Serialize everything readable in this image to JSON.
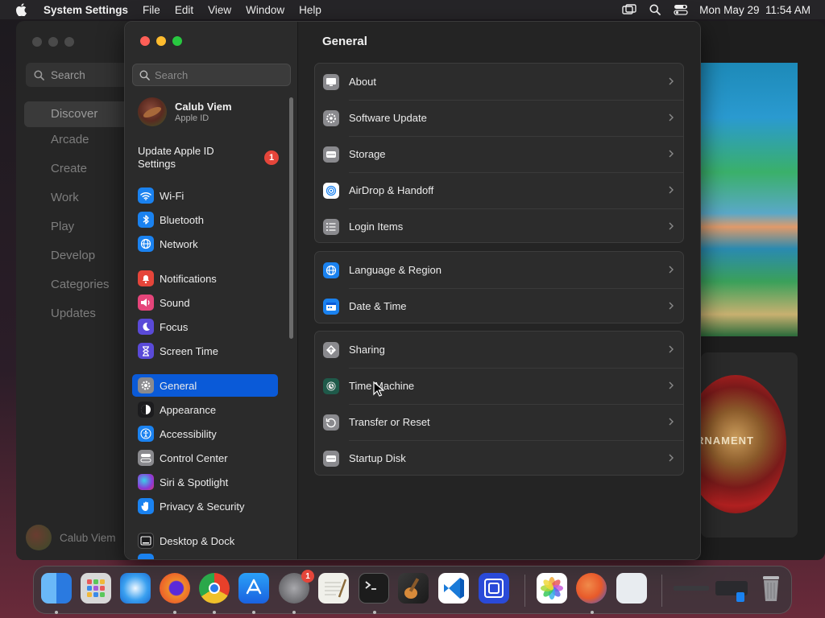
{
  "menubar": {
    "app": "System Settings",
    "items": [
      "File",
      "Edit",
      "View",
      "Window",
      "Help"
    ],
    "datetime": "Mon May 29  11:54 AM"
  },
  "appstore": {
    "search_placeholder": "Search",
    "nav": [
      "Discover",
      "Arcade",
      "Create",
      "Work",
      "Play",
      "Develop",
      "Categories",
      "Updates"
    ],
    "user": "Calub Viem",
    "art_text": "RNAMENT"
  },
  "settings": {
    "search_placeholder": "Search",
    "profile": {
      "name": "Calub Viem",
      "sub": "Apple ID"
    },
    "update": {
      "label": "Update Apple ID Settings",
      "badge": "1"
    },
    "sidebar": [
      {
        "label": "Wi-Fi",
        "icon": "wifi-icon",
        "color": "#1a82f0"
      },
      {
        "label": "Bluetooth",
        "icon": "bluetooth-icon",
        "color": "#1a82f0"
      },
      {
        "label": "Network",
        "icon": "globe-icon",
        "color": "#1a82f0"
      },
      {
        "label": "Notifications",
        "icon": "bell-icon",
        "color": "#e5453a"
      },
      {
        "label": "Sound",
        "icon": "speaker-icon",
        "color": "#e5457a"
      },
      {
        "label": "Focus",
        "icon": "moon-icon",
        "color": "#5a4ad8"
      },
      {
        "label": "Screen Time",
        "icon": "hourglass-icon",
        "color": "#5a4ad8"
      },
      {
        "label": "General",
        "icon": "gear-icon",
        "color": "#8a8a8e"
      },
      {
        "label": "Appearance",
        "icon": "appearance-icon",
        "color": "#1c1c1e"
      },
      {
        "label": "Accessibility",
        "icon": "accessibility-icon",
        "color": "#1a82f0"
      },
      {
        "label": "Control Center",
        "icon": "control-center-icon",
        "color": "#8a8a8e"
      },
      {
        "label": "Siri & Spotlight",
        "icon": "siri-icon",
        "color": "#8a3ad8"
      },
      {
        "label": "Privacy & Security",
        "icon": "hand-icon",
        "color": "#1a82f0"
      },
      {
        "label": "Desktop & Dock",
        "icon": "dock-icon",
        "color": "#1c1c1e"
      }
    ],
    "selected": "General",
    "title": "General",
    "groups": [
      [
        {
          "label": "About",
          "icon": "computer-icon",
          "color": "#8a8a8e"
        },
        {
          "label": "Software Update",
          "icon": "gear-badge-icon",
          "color": "#8a8a8e"
        },
        {
          "label": "Storage",
          "icon": "disk-icon",
          "color": "#8a8a8e"
        },
        {
          "label": "AirDrop & Handoff",
          "icon": "airdrop-icon",
          "color": "#ffffff"
        },
        {
          "label": "Login Items",
          "icon": "list-icon",
          "color": "#8a8a8e"
        }
      ],
      [
        {
          "label": "Language & Region",
          "icon": "globe-icon",
          "color": "#1a82f0"
        },
        {
          "label": "Date & Time",
          "icon": "calendar-icon",
          "color": "#1a82f0"
        }
      ],
      [
        {
          "label": "Sharing",
          "icon": "sharing-icon",
          "color": "#8a8a8e"
        },
        {
          "label": "Time Machine",
          "icon": "time-machine-icon",
          "color": "#1f5a4a"
        },
        {
          "label": "Transfer or Reset",
          "icon": "reset-icon",
          "color": "#8a8a8e"
        },
        {
          "label": "Startup Disk",
          "icon": "disk-icon",
          "color": "#8a8a8e"
        }
      ]
    ]
  },
  "dock": {
    "apps": [
      {
        "name": "finder-icon",
        "color": "#2a8cf0"
      },
      {
        "name": "launchpad-icon",
        "color": "#e8e8e8"
      },
      {
        "name": "safari-icon",
        "color": "#2a9af0"
      },
      {
        "name": "firefox-icon",
        "color": "#e8602a"
      },
      {
        "name": "chrome-icon",
        "color": "#f0f0f0"
      },
      {
        "name": "app-store-icon",
        "color": "#1a82f0"
      },
      {
        "name": "system-settings-icon",
        "color": "#7a7a7e",
        "badge": "1"
      },
      {
        "name": "textedit-icon",
        "color": "#f0f0ea"
      },
      {
        "name": "terminal-icon",
        "color": "#1c1c1c"
      },
      {
        "name": "garageband-icon",
        "color": "#3a3a3a"
      },
      {
        "name": "vscode-icon",
        "color": "#1a7ad8"
      },
      {
        "name": "screen-icon",
        "color": "#2a4ad8"
      },
      {
        "name": "photos-icon",
        "color": "#f0f0f0"
      },
      {
        "name": "kolibri-icon",
        "color": "#e85a2a"
      },
      {
        "name": "blank-icon",
        "color": "#e8ecf0"
      },
      {
        "name": "downloads-stack-icon",
        "color": "#3a3a3e"
      },
      {
        "name": "trash-icon",
        "color": "#9a9a9e"
      }
    ]
  }
}
